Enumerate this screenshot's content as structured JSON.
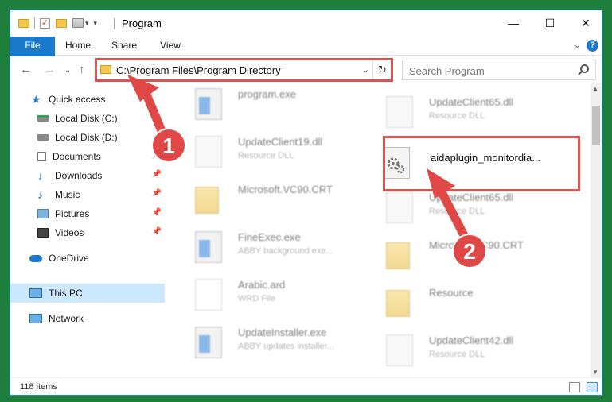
{
  "window": {
    "title": "Program",
    "minimize": "—",
    "maximize": "☐",
    "close": "✕"
  },
  "ribbon": {
    "tabs": [
      "File",
      "Home",
      "Share",
      "View"
    ],
    "help": "?"
  },
  "address": {
    "path": "C:\\Program Files\\Program Directory",
    "search_placeholder": "Search Program"
  },
  "sidebar": {
    "items": [
      {
        "label": "Quick access",
        "icon": "star-icon"
      },
      {
        "label": "Local Disk (C:)",
        "icon": "drive-icon"
      },
      {
        "label": "Local Disk (D:)",
        "icon": "drive-icon"
      },
      {
        "label": "Documents",
        "icon": "documents-icon",
        "pinned": true
      },
      {
        "label": "Downloads",
        "icon": "download-icon",
        "pinned": true
      },
      {
        "label": "Music",
        "icon": "music-icon",
        "pinned": true
      },
      {
        "label": "Pictures",
        "icon": "pictures-icon",
        "pinned": true
      },
      {
        "label": "Videos",
        "icon": "videos-icon",
        "pinned": true
      },
      {
        "label": "OneDrive",
        "icon": "cloud-icon"
      },
      {
        "label": "This PC",
        "icon": "computer-icon",
        "selected": true
      },
      {
        "label": "Network",
        "icon": "network-icon"
      }
    ]
  },
  "files": {
    "left": [
      {
        "name": "program.exe",
        "type": ""
      },
      {
        "name": "UpdateClient19.dll",
        "type": "Resource DLL"
      },
      {
        "name": "Microsoft.VC90.CRT",
        "type": ""
      },
      {
        "name": "FineExec.exe",
        "type": "ABBY background exe..."
      },
      {
        "name": "Arabic.ard",
        "type": "WRD File"
      },
      {
        "name": "UpdateInstaller.exe",
        "type": "ABBY updates installer..."
      }
    ],
    "right": [
      {
        "name": "UpdateClient65.dll",
        "type": "Resource DLL"
      },
      {
        "name": "aidaplugin_monitordia...",
        "type": ""
      },
      {
        "name": "UpdateClient65.dll",
        "type": "Resource DLL"
      },
      {
        "name": "Microsoft.VC90.CRT",
        "type": ""
      },
      {
        "name": "Resource",
        "type": ""
      },
      {
        "name": "UpdateClient42.dll",
        "type": "Resource DLL"
      }
    ]
  },
  "status": {
    "item_count": "118 items"
  },
  "annotations": {
    "step1": "1",
    "step2": "2",
    "color": "#e04848"
  }
}
